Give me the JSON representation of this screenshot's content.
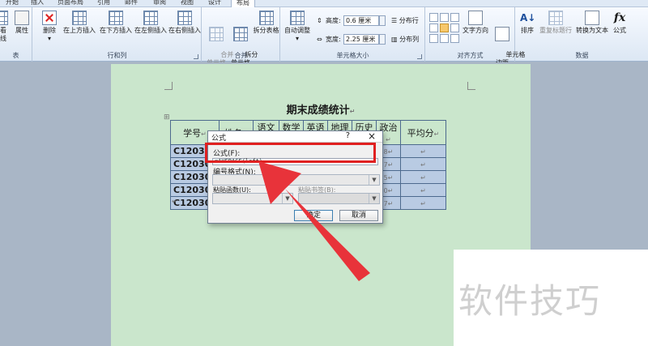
{
  "ribbon_tabs": [
    "开始",
    "插入",
    "页面布局",
    "引用",
    "邮件",
    "审阅",
    "视图",
    "设计",
    "布局"
  ],
  "ribbon": {
    "left_partial": {
      "view_label": "看",
      "gridlines_label": "线",
      "properties_label": "属性",
      "group_label": "表"
    },
    "rows_cols": {
      "delete_label": "删除",
      "insert_above_label": "在上方插入",
      "insert_below_label": "在下方插入",
      "insert_left_label": "在左侧插入",
      "insert_right_label": "在右侧插入",
      "group_label": "行和列"
    },
    "merge": {
      "merge_cells_label": "合并\n单元格",
      "split_cells_label": "拆分\n单元格",
      "split_table_label": "拆分表格",
      "group_label": "合并"
    },
    "cell_size": {
      "autofit_label": "自动调整",
      "height_label": "高度:",
      "height_value": "0.6 厘米",
      "width_label": "宽度:",
      "width_value": "2.25 厘米",
      "distribute_rows_label": "分布行",
      "distribute_cols_label": "分布列",
      "group_label": "单元格大小"
    },
    "alignment": {
      "text_direction_label": "文字方向",
      "cell_margins_label": "单元格\n边距",
      "group_label": "对齐方式"
    },
    "data": {
      "sort_label": "排序",
      "repeat_header_label": "重复标题行",
      "convert_text_label": "转换为文本",
      "formula_label": "公式",
      "group_label": "数据"
    }
  },
  "document": {
    "title": "期末成绩统计",
    "table": {
      "headers": [
        "学号",
        "姓名",
        "语文",
        "数学",
        "英语",
        "地理",
        "历史",
        "政治",
        "平均分"
      ],
      "rows": [
        {
          "id": "C120305",
          "tail": "8"
        },
        {
          "id": "C120306",
          "tail": "7"
        },
        {
          "id": "C120307",
          "tail": "5"
        },
        {
          "id": "C120308",
          "tail": "0"
        },
        {
          "id": "C120309",
          "tail": "7"
        }
      ]
    }
  },
  "dialog": {
    "title": "公式",
    "help": "?",
    "close": "×",
    "formula_label": "公式(F):",
    "formula_value": "=AVERAGE(left)",
    "number_format_label": "编号格式(N):",
    "paste_function_label": "粘贴函数(U):",
    "paste_bookmark_label": "粘贴书签(B):",
    "ok_label": "确定",
    "cancel_label": "取消"
  },
  "watermark": "软件技巧",
  "colors": {
    "highlight": "#e02020",
    "page": "#cae6cc",
    "selected_row": "#b9cbe3"
  }
}
